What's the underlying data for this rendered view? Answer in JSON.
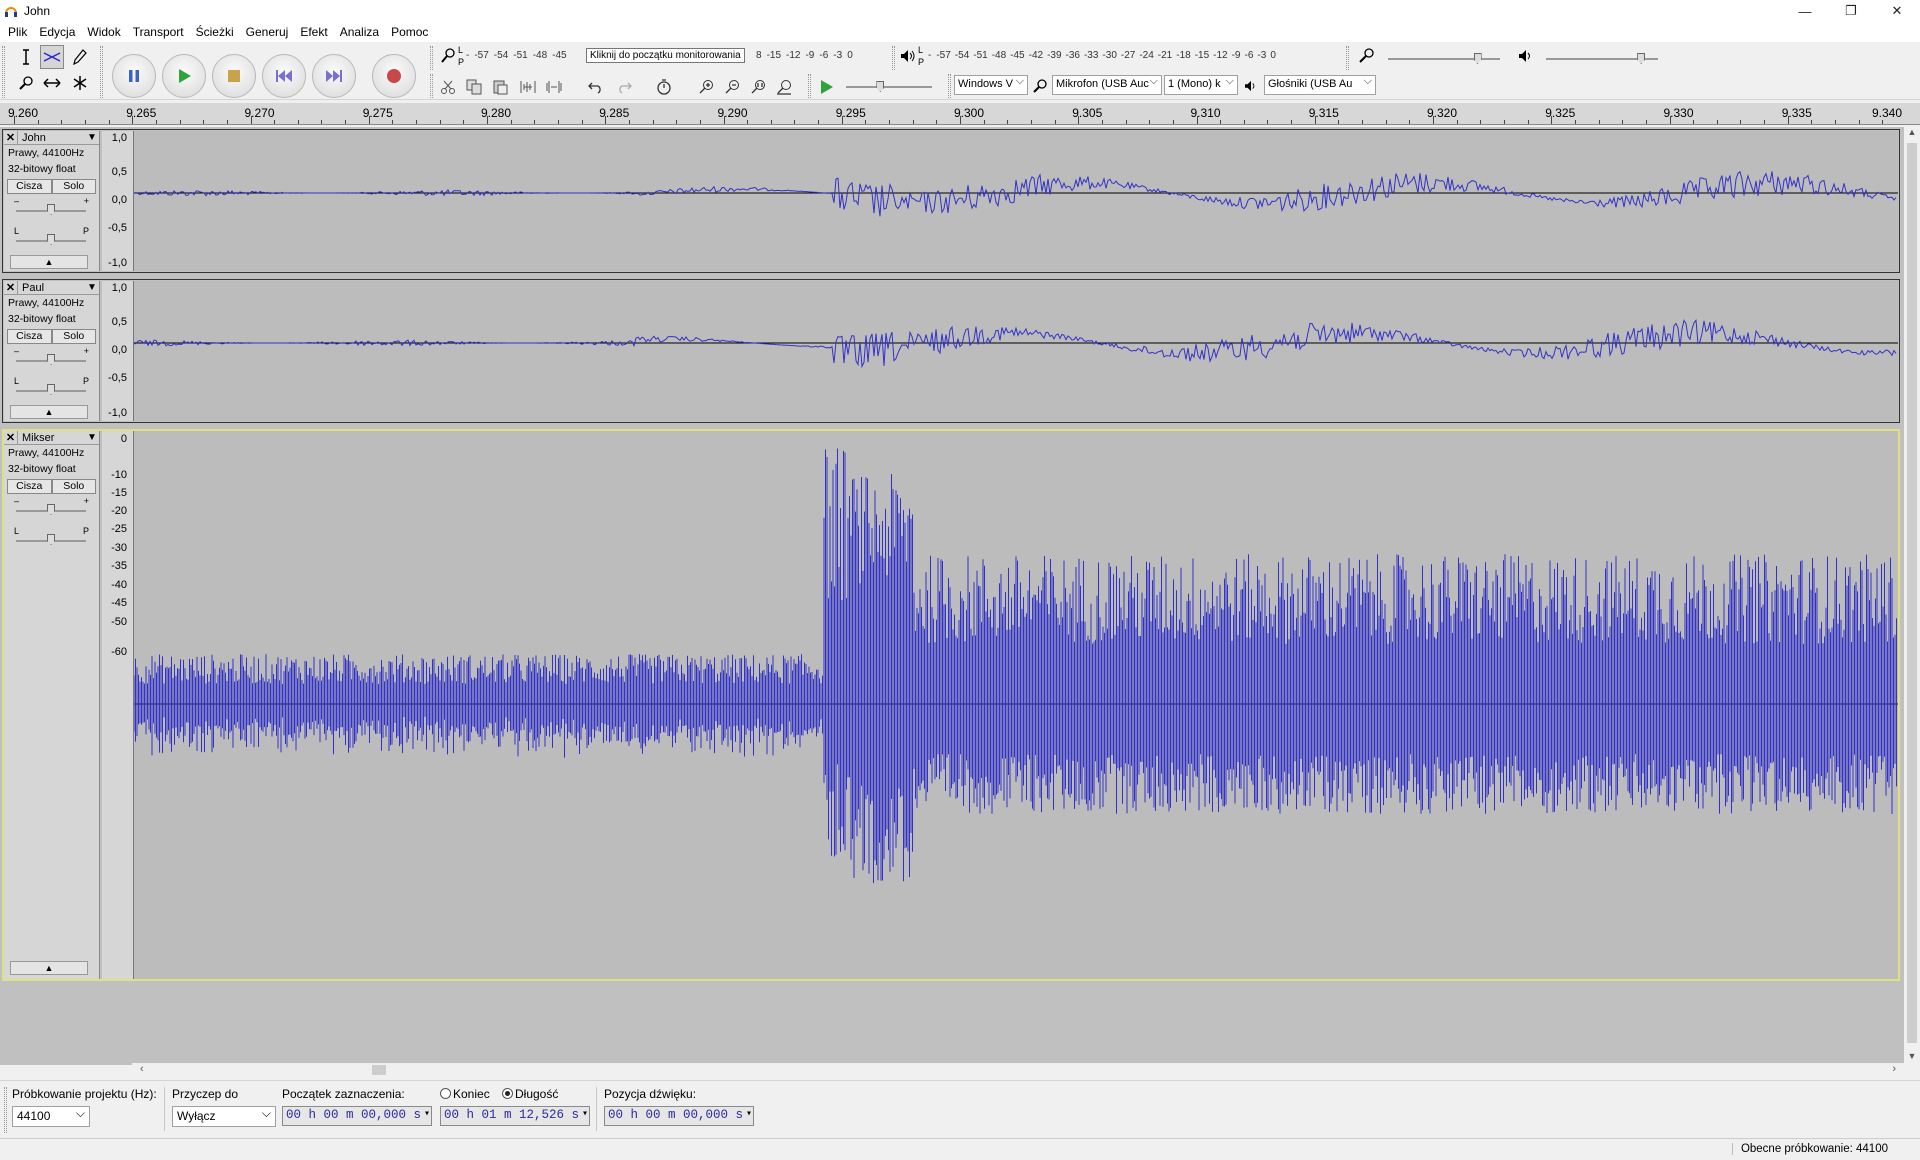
{
  "window": {
    "title": "John",
    "minimize": "—",
    "restore": "❐",
    "close": "✕"
  },
  "menu": [
    "Plik",
    "Edycja",
    "Widok",
    "Transport",
    "Ścieżki",
    "Generuj",
    "Efekt",
    "Analiza",
    "Pomoc"
  ],
  "toolbars": {
    "tools": [
      "selection-tool",
      "envelope-tool",
      "draw-tool",
      "zoom-tool",
      "time-shift-tool",
      "multi-tool"
    ],
    "transport": [
      "pause",
      "play",
      "stop",
      "skip-to-start",
      "skip-to-end",
      "record"
    ],
    "recording_meter_scale": [
      "-57",
      "-54",
      "-51",
      "-48",
      "-45"
    ],
    "recording_meter_scale_tail": [
      "-15",
      "-12",
      "-9",
      "-6",
      "-3",
      "0"
    ],
    "recording_meter_tooltip": "Kliknij do początku monitorowania",
    "playback_meter_scale": [
      "-57",
      "-54",
      "-51",
      "-48",
      "-45",
      "-42",
      "-39",
      "-36",
      "-33",
      "-30",
      "-27",
      "-24",
      "-21",
      "-18",
      "-15",
      "-12",
      "-9",
      "-6",
      "-3",
      "0"
    ],
    "meter_lr": {
      "l": "L",
      "r": "P"
    },
    "mixer": {
      "input_level": 0.8,
      "output_level": 0.85
    },
    "play_at_speed_level": 0.4,
    "device": {
      "host": "Windows V",
      "input_device": "Mikrofon (USB Auc",
      "channels": "1 (Mono) k",
      "output_device": "Głośniki (USB Au"
    }
  },
  "ruler": {
    "labels": [
      "9.260",
      "9.265",
      "9.270",
      "9.275",
      "9.280",
      "9.285",
      "9.290",
      "9.295",
      "9.300",
      "9.305",
      "9.310",
      "9.315",
      "9.320",
      "9.325",
      "9.330",
      "9.335",
      "9.340"
    ]
  },
  "tracks": [
    {
      "name": "John",
      "info1": "Prawy, 44100Hz",
      "info2": "32-bitowy float",
      "mute": "Cisza",
      "solo": "Solo",
      "gain_minus": "–",
      "gain_plus": "+",
      "pan_l": "L",
      "pan_r": "P",
      "scale": [
        "1,0",
        "0,5",
        "0,0",
        "-0,5",
        "-1,0"
      ],
      "selected": false
    },
    {
      "name": "Paul",
      "info1": "Prawy, 44100Hz",
      "info2": "32-bitowy float",
      "mute": "Cisza",
      "solo": "Solo",
      "gain_minus": "–",
      "gain_plus": "+",
      "pan_l": "L",
      "pan_r": "P",
      "scale": [
        "1,0",
        "0,5",
        "0,0",
        "-0,5",
        "-1,0"
      ],
      "selected": false
    },
    {
      "name": "Mikser",
      "info1": "Prawy, 44100Hz",
      "info2": "32-bitowy float",
      "mute": "Cisza",
      "solo": "Solo",
      "gain_minus": "–",
      "gain_plus": "+",
      "pan_l": "L",
      "pan_r": "P",
      "scale": [
        "0",
        "-10",
        "-15",
        "-20",
        "-25",
        "-30",
        "-35",
        "-40",
        "-45",
        "-50",
        "-60"
      ],
      "selected": true
    }
  ],
  "selection_bar": {
    "rate_label": "Próbkowanie projektu (Hz):",
    "rate_value": "44100",
    "snap_label": "Przyczep do",
    "snap_value": "Wyłącz",
    "start_label": "Początek zaznaczenia:",
    "start_value": "00 h 00 m 00,000 s",
    "end_label": "Koniec",
    "length_label": "Długość",
    "length_value": "00 h 01 m 12,526 s",
    "position_label": "Pozycja dźwięku:",
    "position_value": "00 h 00 m 00,000 s"
  },
  "status": {
    "rate": "Obecne próbkowanie: 44100"
  },
  "colors": {
    "waveform": "#3232c8",
    "track_bg": "#bcbcbc",
    "selected_border": "#e0e080"
  }
}
